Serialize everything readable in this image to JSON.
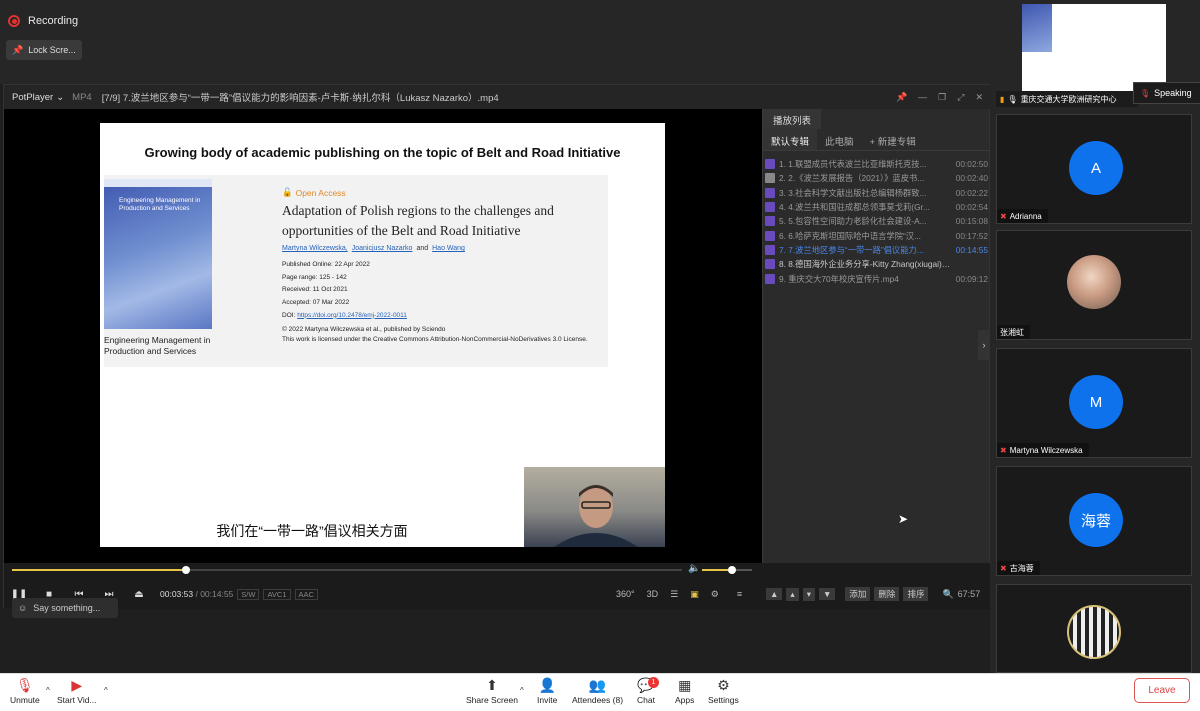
{
  "zoom": {
    "recording_label": "Recording",
    "lock_label": "Lock Scre...",
    "say_placeholder": "Say something...",
    "toolbar": {
      "unmute": "Unmute",
      "start_video": "Start Vid...",
      "share_screen": "Share Screen",
      "invite": "Invite",
      "attendees": "Attendees (8)",
      "chat": "Chat",
      "chat_badge": "1",
      "apps": "Apps",
      "settings": "Settings",
      "leave": "Leave"
    }
  },
  "player": {
    "app_name": "PotPlayer",
    "format": "MP4",
    "title": "[7/9] 7.波兰地区参与“一带一路”倡议能力的影响因素-卢卡斯·纳扎尔科（Lukasz Nazarko）.mp4",
    "time_current": "00:03:53",
    "time_total": "/ 00:14:55",
    "tags": [
      "S/W",
      "AVC1",
      "AAC"
    ],
    "progress": 0.26,
    "volume": 0.6,
    "right_icons": [
      "360°",
      "3D"
    ],
    "playlist": {
      "tab": "播放列表",
      "subtabs": [
        "默认专辑",
        "此电脑",
        "+ 新建专辑"
      ],
      "items": [
        {
          "name": "1. 1.联盟成员代表波兰比亚维斯托克技...",
          "dur": "00:02:50"
        },
        {
          "name": "2. 2.《波兰发展报告（2021）》蓝皮书...",
          "dur": "00:02:40"
        },
        {
          "name": "3. 3.社会科学文献出版社总编辑杨群致...",
          "dur": "00:02:22"
        },
        {
          "name": "4. 4.波兰共和国驻成都总领事莫戈莉(Gr...",
          "dur": "00:02:54"
        },
        {
          "name": "5. 5.包容性空间助力老龄化社会建设-A...",
          "dur": "00:15:08"
        },
        {
          "name": "6. 6.哈萨克斯坦国际哈中语言学院“汉...",
          "dur": "00:17:52"
        },
        {
          "name": "7. 7.波兰地区参与“一带一路”倡议能力...",
          "dur": "00:14:55"
        },
        {
          "name": "8. 8.德国海外企业务分享-Kitty Zhang(xiugai).mp4",
          "dur": ""
        },
        {
          "name": "9. 重庆交大70年校庆宣传片.mp4",
          "dur": "00:09:12"
        }
      ],
      "bottom_buttons": [
        "添加",
        "删除",
        "排序"
      ],
      "bottom_time": "67:57"
    }
  },
  "slide": {
    "title": "Growing body of academic publishing on the topic of Belt and Road Initiative",
    "cover_text": "Engineering Management in Production and Services",
    "cover_caption": "Engineering Management in Production and Services",
    "open_access": "Open Access",
    "paper_title": "Adaptation of Polish regions to the challenges and opportunities of the Belt and Road Initiative",
    "authors": [
      "Martyna Wilczewska,",
      "Joanicjusz Nazarko",
      "and",
      "Hao Wang"
    ],
    "published": "Published Online: 22 Apr 2022",
    "pages": "Page range: 125 - 142",
    "received": "Received: 11 Oct 2021",
    "accepted": "Accepted: 07 Mar 2022",
    "doi_label": "DOI:",
    "doi": "https://doi.org/10.2478/emj-2022-0011",
    "copyright": "© 2022 Martyna Wilczewska et al., published by Sciendo",
    "license": "This work is licensed under the Creative Commons Attribution-NonCommercial-NoDerivatives 3.0 License.",
    "subtitle": "我们在“一带一路”倡议相关方面"
  },
  "participants": {
    "share_name": "重庆交通大学欧洲研究中心",
    "speaking": "Speaking",
    "tiles": [
      {
        "name": "Adrianna",
        "initial": "A"
      },
      {
        "name": "张湘虹",
        "initial": ""
      },
      {
        "name": "Martyna Wilczewska",
        "initial": "M"
      },
      {
        "name": "古海蓉",
        "initial": "海蓉"
      }
    ]
  }
}
